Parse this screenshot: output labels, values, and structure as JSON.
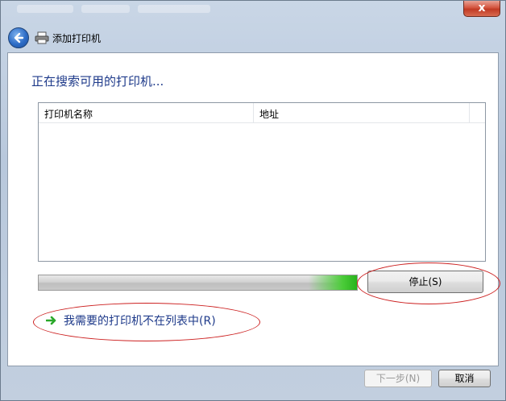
{
  "window": {
    "title": "添加打印机",
    "close_label": "x"
  },
  "main": {
    "heading": "正在搜索可用的打印机...",
    "list": {
      "columns": [
        "打印机名称",
        "地址"
      ],
      "rows": []
    },
    "progress_percent": 100,
    "stop_label": "停止(S)",
    "missing_printer_link": "我需要的打印机不在列表中(R)"
  },
  "footer": {
    "next_label": "下一步(N)",
    "cancel_label": "取消"
  },
  "colors": {
    "accent_text": "#1e3a8a",
    "annotation": "#cc1f1f",
    "progress_glow": "#4ccc3a"
  },
  "icons": {
    "back": "back-arrow-icon",
    "printer": "printer-icon",
    "link": "green-arrow-icon"
  }
}
